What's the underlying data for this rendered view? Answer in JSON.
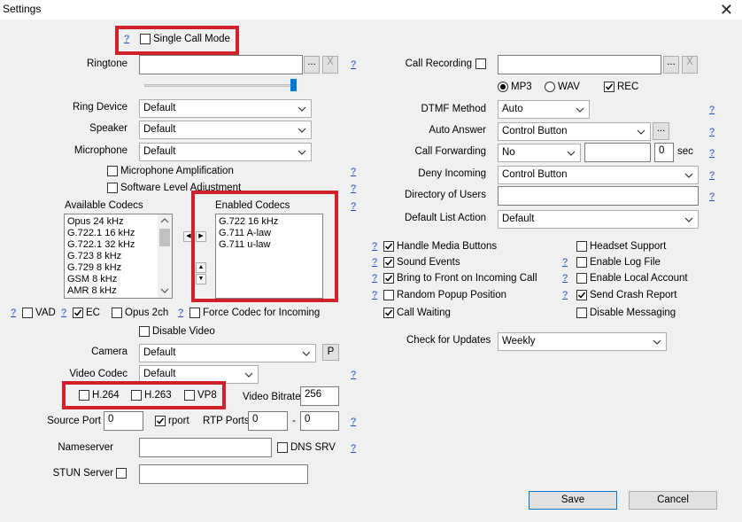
{
  "window": {
    "title": "Settings",
    "close_glyph": "✕"
  },
  "help": "?",
  "left": {
    "single_call_mode": {
      "label": "Single Call Mode",
      "checked": false
    },
    "ringtone": {
      "label": "Ringtone",
      "value": "",
      "browse": "...",
      "clear": "X",
      "volume_percent": 100
    },
    "ring_device": {
      "label": "Ring Device",
      "value": "Default"
    },
    "speaker": {
      "label": "Speaker",
      "value": "Default"
    },
    "microphone": {
      "label": "Microphone",
      "value": "Default"
    },
    "mic_amplification": {
      "label": "Microphone Amplification",
      "checked": false
    },
    "software_level": {
      "label": "Software Level Adjustment",
      "checked": false
    },
    "available_codecs": {
      "label": "Available Codecs",
      "items": [
        "Opus 24 kHz",
        "G.722.1 16 kHz",
        "G.722.1 32 kHz",
        "G.723 8 kHz",
        "G.729 8 kHz",
        "GSM 8 kHz",
        "AMR 8 kHz"
      ]
    },
    "enabled_codecs": {
      "label": "Enabled Codecs",
      "items": [
        "G.722 16 kHz",
        "G.711 A-law",
        "G.711 u-law"
      ]
    },
    "vad": {
      "label": "VAD",
      "checked": false
    },
    "ec": {
      "label": "EC",
      "checked": true
    },
    "opus2ch": {
      "label": "Opus 2ch",
      "checked": false
    },
    "force_codec": {
      "label": "Force Codec for Incoming",
      "checked": false
    },
    "disable_video": {
      "label": "Disable Video",
      "checked": false
    },
    "camera": {
      "label": "Camera",
      "value": "Default",
      "btn": "P"
    },
    "video_codec": {
      "label": "Video Codec",
      "value": "Default"
    },
    "h264": {
      "label": "H.264",
      "checked": false
    },
    "h263": {
      "label": "H.263",
      "checked": false
    },
    "vp8": {
      "label": "VP8",
      "checked": false
    },
    "video_bitrate": {
      "label": "Video Bitrate",
      "value": "256"
    },
    "source_port": {
      "label": "Source Port",
      "value": "0"
    },
    "rport": {
      "label": "rport",
      "checked": true
    },
    "rtp_ports": {
      "label": "RTP Ports",
      "from": "0",
      "dash": "-",
      "to": "0"
    },
    "nameserver": {
      "label": "Nameserver",
      "value": ""
    },
    "dns_srv": {
      "label": "DNS SRV",
      "checked": false
    },
    "stun": {
      "label": "STUN Server",
      "checked": false,
      "value": ""
    }
  },
  "right": {
    "call_recording": {
      "label": "Call Recording",
      "checked": false,
      "value": "",
      "browse": "...",
      "clear": "X"
    },
    "format_mp3": {
      "label": "MP3",
      "selected": true
    },
    "format_wav": {
      "label": "WAV",
      "selected": false
    },
    "rec": {
      "label": "REC",
      "checked": true
    },
    "dtmf": {
      "label": "DTMF Method",
      "value": "Auto"
    },
    "auto_answer": {
      "label": "Auto Answer",
      "value": "Control Button",
      "btn": "..."
    },
    "call_forwarding": {
      "label": "Call Forwarding",
      "value": "No",
      "target": "",
      "delay": "0",
      "unit": "sec"
    },
    "deny_incoming": {
      "label": "Deny Incoming",
      "value": "Control Button"
    },
    "directory": {
      "label": "Directory of Users",
      "value": ""
    },
    "default_list": {
      "label": "Default List Action",
      "value": "Default"
    },
    "options_left": [
      {
        "label": "Handle Media Buttons",
        "checked": true
      },
      {
        "label": "Sound Events",
        "checked": true
      },
      {
        "label": "Bring to Front on Incoming Call",
        "checked": true
      },
      {
        "label": "Random Popup Position",
        "checked": false
      },
      {
        "label": "Call Waiting",
        "checked": true
      }
    ],
    "options_right": [
      {
        "label": "Headset Support",
        "checked": false
      },
      {
        "label": "Enable Log File",
        "checked": false
      },
      {
        "label": "Enable Local Account",
        "checked": false
      },
      {
        "label": "Send Crash Report",
        "checked": true
      },
      {
        "label": "Disable Messaging",
        "checked": false
      }
    ],
    "check_updates": {
      "label": "Check for Updates",
      "value": "Weekly"
    }
  },
  "footer": {
    "save": "Save",
    "cancel": "Cancel"
  }
}
